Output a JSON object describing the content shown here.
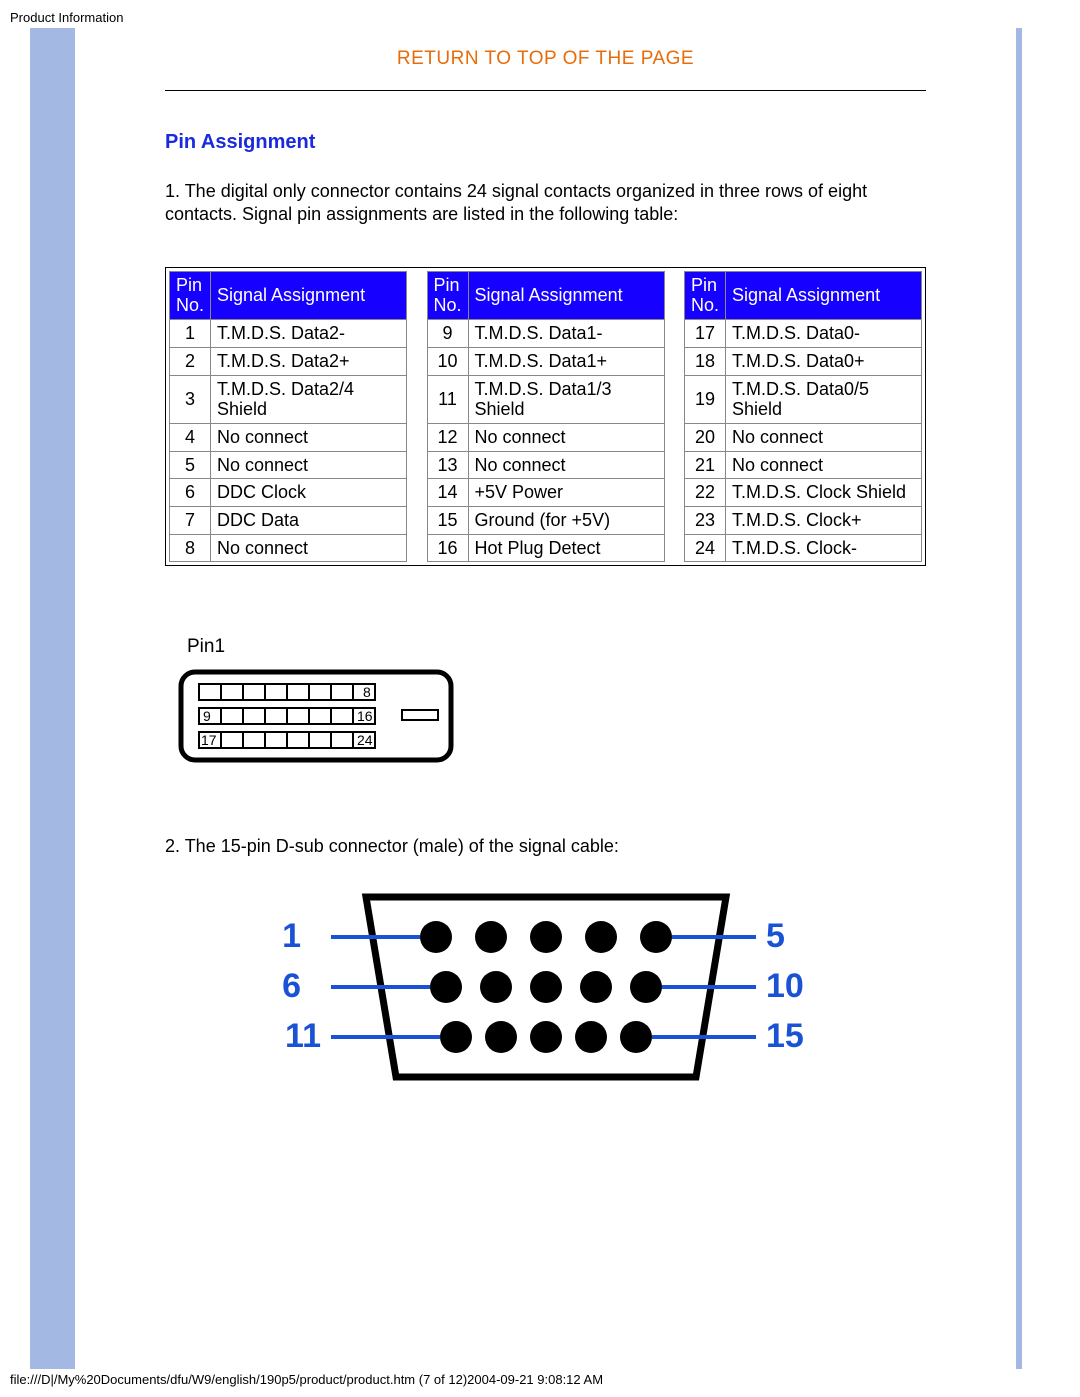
{
  "header": "Product Information",
  "footer": "file:///D|/My%20Documents/dfu/W9/english/190p5/product/product.htm (7 of 12)2004-09-21 9:08:12 AM",
  "top_link": "RETURN TO TOP OF THE PAGE",
  "section_title": "Pin Assignment",
  "intro": "1. The digital only connector contains 24 signal contacts organized in three rows of eight contacts. Signal pin assignments are listed in the following table:",
  "table_headers": {
    "pin": "Pin No.",
    "sig": "Signal Assignment"
  },
  "cols": [
    [
      {
        "pin": "1",
        "sig": "T.M.D.S. Data2-"
      },
      {
        "pin": "2",
        "sig": "T.M.D.S. Data2+"
      },
      {
        "pin": "3",
        "sig": "T.M.D.S. Data2/4 Shield"
      },
      {
        "pin": "4",
        "sig": "No connect"
      },
      {
        "pin": "5",
        "sig": "No connect"
      },
      {
        "pin": "6",
        "sig": "DDC Clock"
      },
      {
        "pin": "7",
        "sig": "DDC Data"
      },
      {
        "pin": "8",
        "sig": "No connect"
      }
    ],
    [
      {
        "pin": "9",
        "sig": "T.M.D.S. Data1-"
      },
      {
        "pin": "10",
        "sig": "T.M.D.S. Data1+"
      },
      {
        "pin": "11",
        "sig": "T.M.D.S. Data1/3 Shield"
      },
      {
        "pin": "12",
        "sig": "No connect"
      },
      {
        "pin": "13",
        "sig": "No connect"
      },
      {
        "pin": "14",
        "sig": "+5V Power"
      },
      {
        "pin": "15",
        "sig": "Ground (for +5V)"
      },
      {
        "pin": "16",
        "sig": "Hot Plug Detect"
      }
    ],
    [
      {
        "pin": "17",
        "sig": "T.M.D.S. Data0-"
      },
      {
        "pin": "18",
        "sig": "T.M.D.S. Data0+"
      },
      {
        "pin": "19",
        "sig": "T.M.D.S. Data0/5 Shield"
      },
      {
        "pin": "20",
        "sig": "No connect"
      },
      {
        "pin": "21",
        "sig": "No connect"
      },
      {
        "pin": "22",
        "sig": "T.M.D.S. Clock Shield"
      },
      {
        "pin": "23",
        "sig": "T.M.D.S. Clock+"
      },
      {
        "pin": "24",
        "sig": "T.M.D.S. Clock-"
      }
    ]
  ],
  "dvi_pin_label": "Pin1",
  "dvi_nums": {
    "r1": "8",
    "r2l": "9",
    "r2r": "16",
    "r3l": "17",
    "r3r": "24"
  },
  "vga_intro": "2. The 15-pin D-sub connector (male) of the signal cable:",
  "vga_labels": {
    "l1": "1",
    "l2": "6",
    "l3": "11",
    "r1": "5",
    "r2": "10",
    "r3": "15"
  }
}
